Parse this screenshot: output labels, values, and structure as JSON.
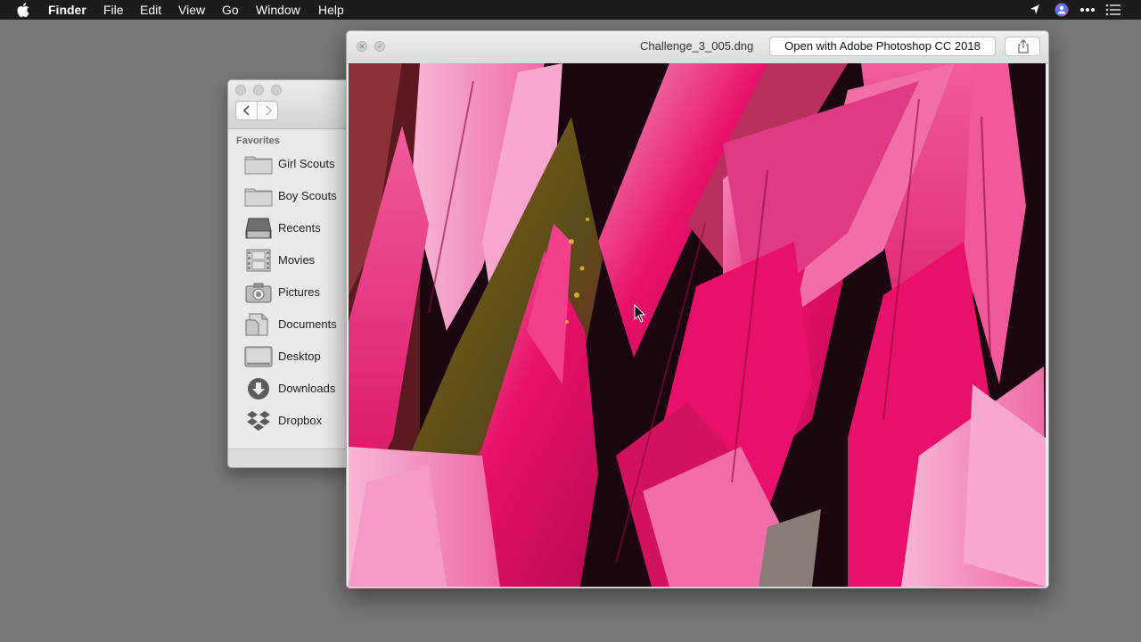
{
  "menubar": {
    "app_name": "Finder",
    "items": [
      "File",
      "Edit",
      "View",
      "Go",
      "Window",
      "Help"
    ],
    "right_icons": [
      "location-arrow-icon",
      "siri-icon",
      "more-icon",
      "notification-list-icon"
    ]
  },
  "finder": {
    "favorites_label": "Favorites",
    "items": [
      {
        "label": "Girl Scouts",
        "icon": "folder-icon"
      },
      {
        "label": "Boy Scouts",
        "icon": "folder-icon"
      },
      {
        "label": "Recents",
        "icon": "recents-icon"
      },
      {
        "label": "Movies",
        "icon": "movies-icon"
      },
      {
        "label": "Pictures",
        "icon": "camera-icon"
      },
      {
        "label": "Documents",
        "icon": "documents-icon"
      },
      {
        "label": "Desktop",
        "icon": "desktop-icon"
      },
      {
        "label": "Downloads",
        "icon": "download-icon"
      },
      {
        "label": "Dropbox",
        "icon": "dropbox-icon"
      }
    ]
  },
  "quicklook": {
    "filename": "Challenge_3_005.dng",
    "open_button": "Open with Adobe Photoshop CC 2018",
    "share_icon": "share-icon"
  },
  "colors": {
    "desktop": "#777777",
    "menubar": "#1c1c1c",
    "leaf_pink": "#e8106a",
    "leaf_light": "#f06fa8",
    "leaf_dark_green": "#5a4a18"
  }
}
